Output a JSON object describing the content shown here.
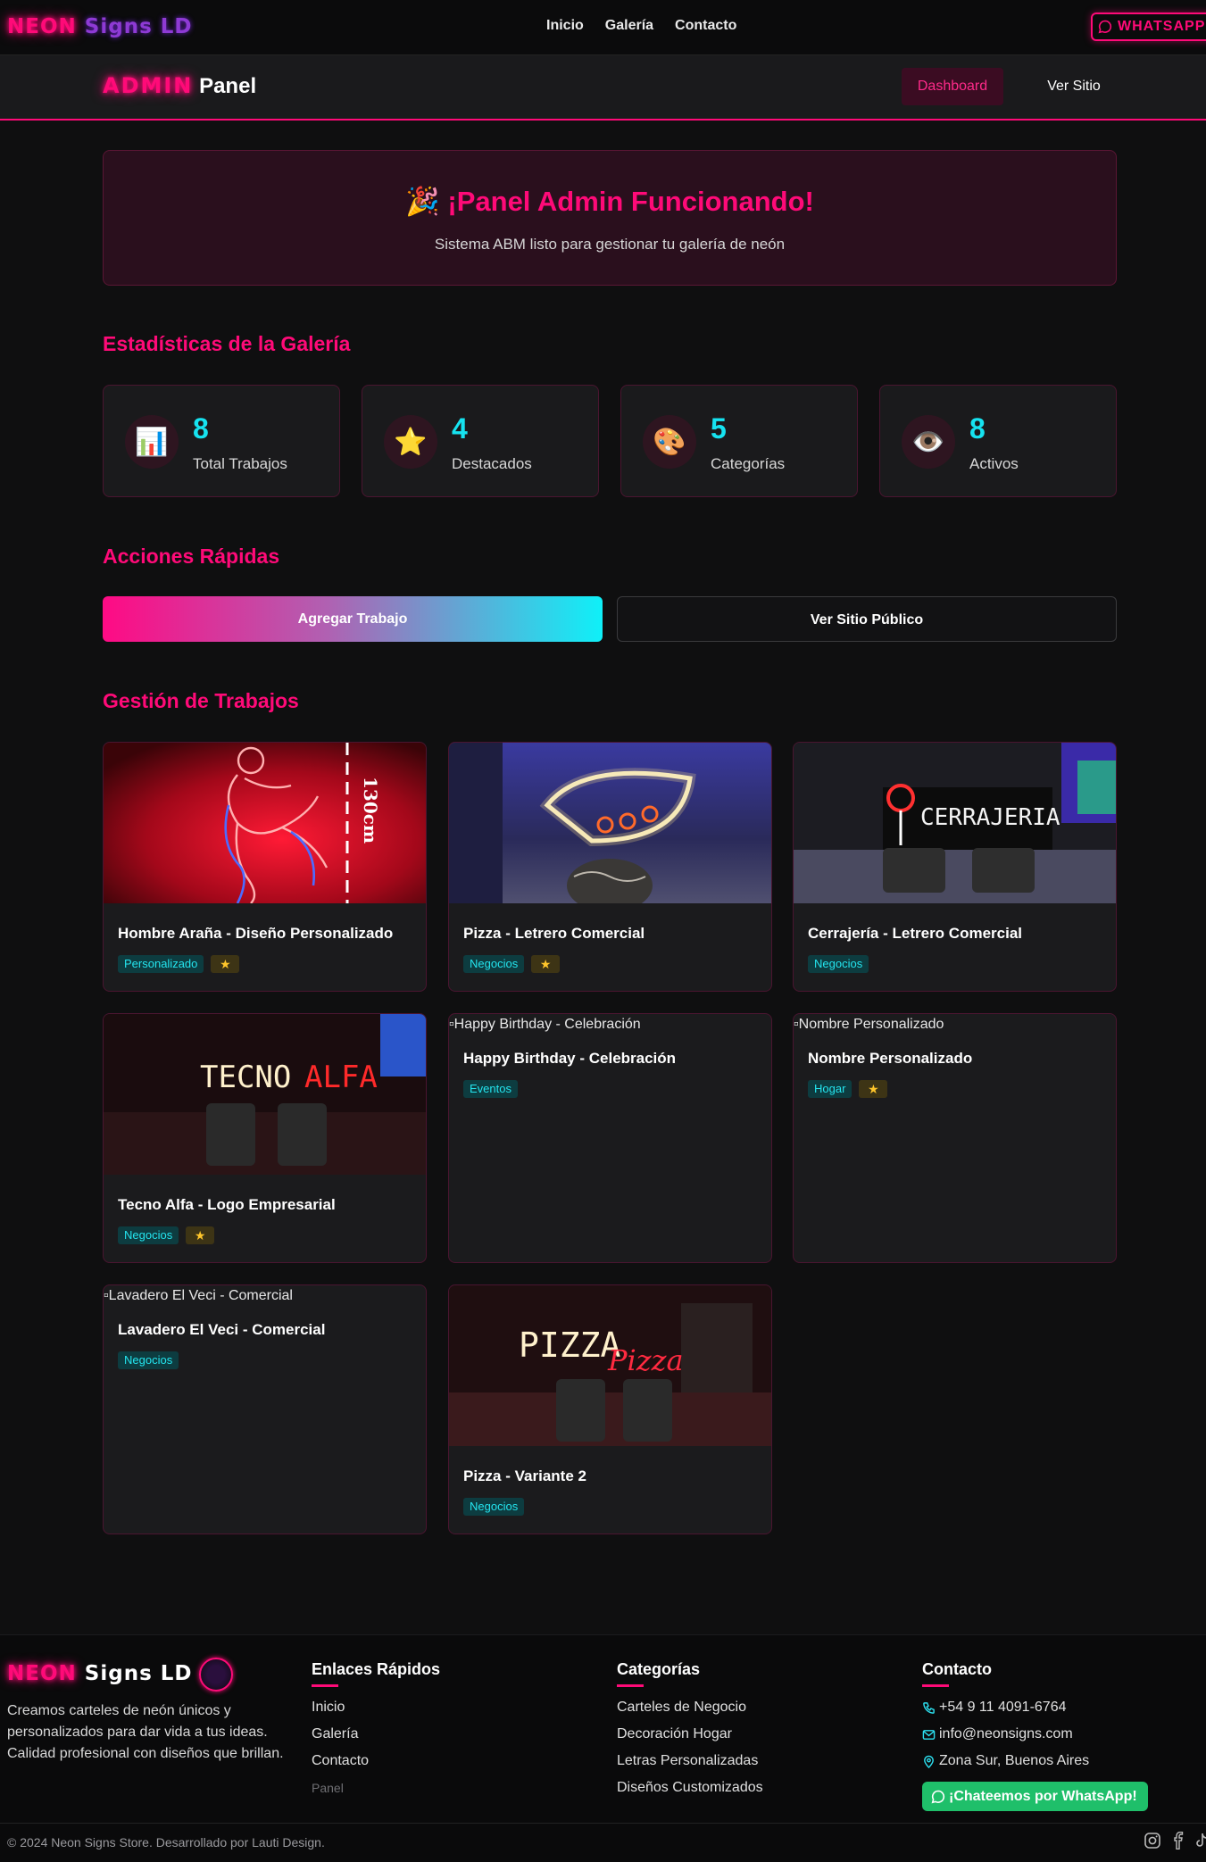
{
  "nav": {
    "brand_neon": "NEON",
    "brand_rest": "Signs LD",
    "links": [
      "Inicio",
      "Galería",
      "Contacto"
    ],
    "whatsapp": "WHATSAPP"
  },
  "admin": {
    "title_a": "ADMIN",
    "title_b": "Panel",
    "dashboard": "Dashboard",
    "ver_sitio": "Ver Sitio"
  },
  "banner": {
    "emoji": "🎉",
    "title": "¡Panel Admin Funcionando!",
    "subtitle": "Sistema ABM listo para gestionar tu galería de neón"
  },
  "stats": {
    "title": "Estadísticas de la Galería",
    "items": [
      {
        "icon": "bar-chart-icon",
        "glyph": "📊",
        "value": "8",
        "label": "Total Trabajos"
      },
      {
        "icon": "star-icon",
        "glyph": "⭐",
        "value": "4",
        "label": "Destacados"
      },
      {
        "icon": "palette-icon",
        "glyph": "🎨",
        "value": "5",
        "label": "Categorías"
      },
      {
        "icon": "eye-icon",
        "glyph": "👁️",
        "value": "8",
        "label": "Activos"
      }
    ]
  },
  "actions": {
    "title": "Acciones Rápidas",
    "add": "Agregar Trabajo",
    "public": "Ver Sitio Público"
  },
  "jobs": {
    "title": "Gestión de Trabajos",
    "items": [
      {
        "title": "Hombre Araña - Diseño Personalizado",
        "tag": "Personalizado",
        "featured": true,
        "image": "spiderman",
        "image_text": "130cm"
      },
      {
        "title": "Pizza - Letrero Comercial",
        "tag": "Negocios",
        "featured": true,
        "image": "pizza"
      },
      {
        "title": "Cerrajería - Letrero Comercial",
        "tag": "Negocios",
        "featured": false,
        "image": "cerrajeria",
        "image_text": "CERRAJERIA"
      },
      {
        "title": "Tecno Alfa - Logo Empresarial",
        "tag": "Negocios",
        "featured": true,
        "image": "tecnoalfa",
        "image_text": [
          "TECNO",
          "ALFA"
        ]
      },
      {
        "title": "Happy Birthday - Celebración",
        "tag": "Eventos",
        "featured": false,
        "alt": "Happy Birthday - Celebración"
      },
      {
        "title": "Nombre Personalizado",
        "tag": "Hogar",
        "featured": true,
        "alt": "Nombre Personalizado"
      },
      {
        "title": "Lavadero El Veci - Comercial",
        "tag": "Negocios",
        "featured": false,
        "alt": "Lavadero El Veci - Comercial"
      },
      {
        "title": "Pizza - Variante 2",
        "tag": "Negocios",
        "featured": false,
        "image": "pizza2",
        "image_text": [
          "PIZZA",
          "Pizza"
        ]
      }
    ]
  },
  "footer": {
    "brand_neon": "NEON",
    "brand_rest": "Signs LD",
    "description": "Creamos carteles de neón únicos y personalizados para dar vida a tus ideas. Calidad profesional con diseños que brillan.",
    "links_title": "Enlaces Rápidos",
    "links": [
      "Inicio",
      "Galería",
      "Contacto"
    ],
    "panel": "Panel",
    "categories_title": "Categorías",
    "categories": [
      "Carteles de Negocio",
      "Decoración Hogar",
      "Letras Personalizadas",
      "Diseños Customizados"
    ],
    "contact_title": "Contacto",
    "phone": "+54 9 11 4091-6764",
    "email": "info@neonsigns.com",
    "location": "Zona Sur, Buenos Aires",
    "whatsapp_btn": "¡Chateemos por WhatsApp!",
    "copyright": "© 2024 Neon Signs Store. Desarrollado por Lauti Design."
  }
}
